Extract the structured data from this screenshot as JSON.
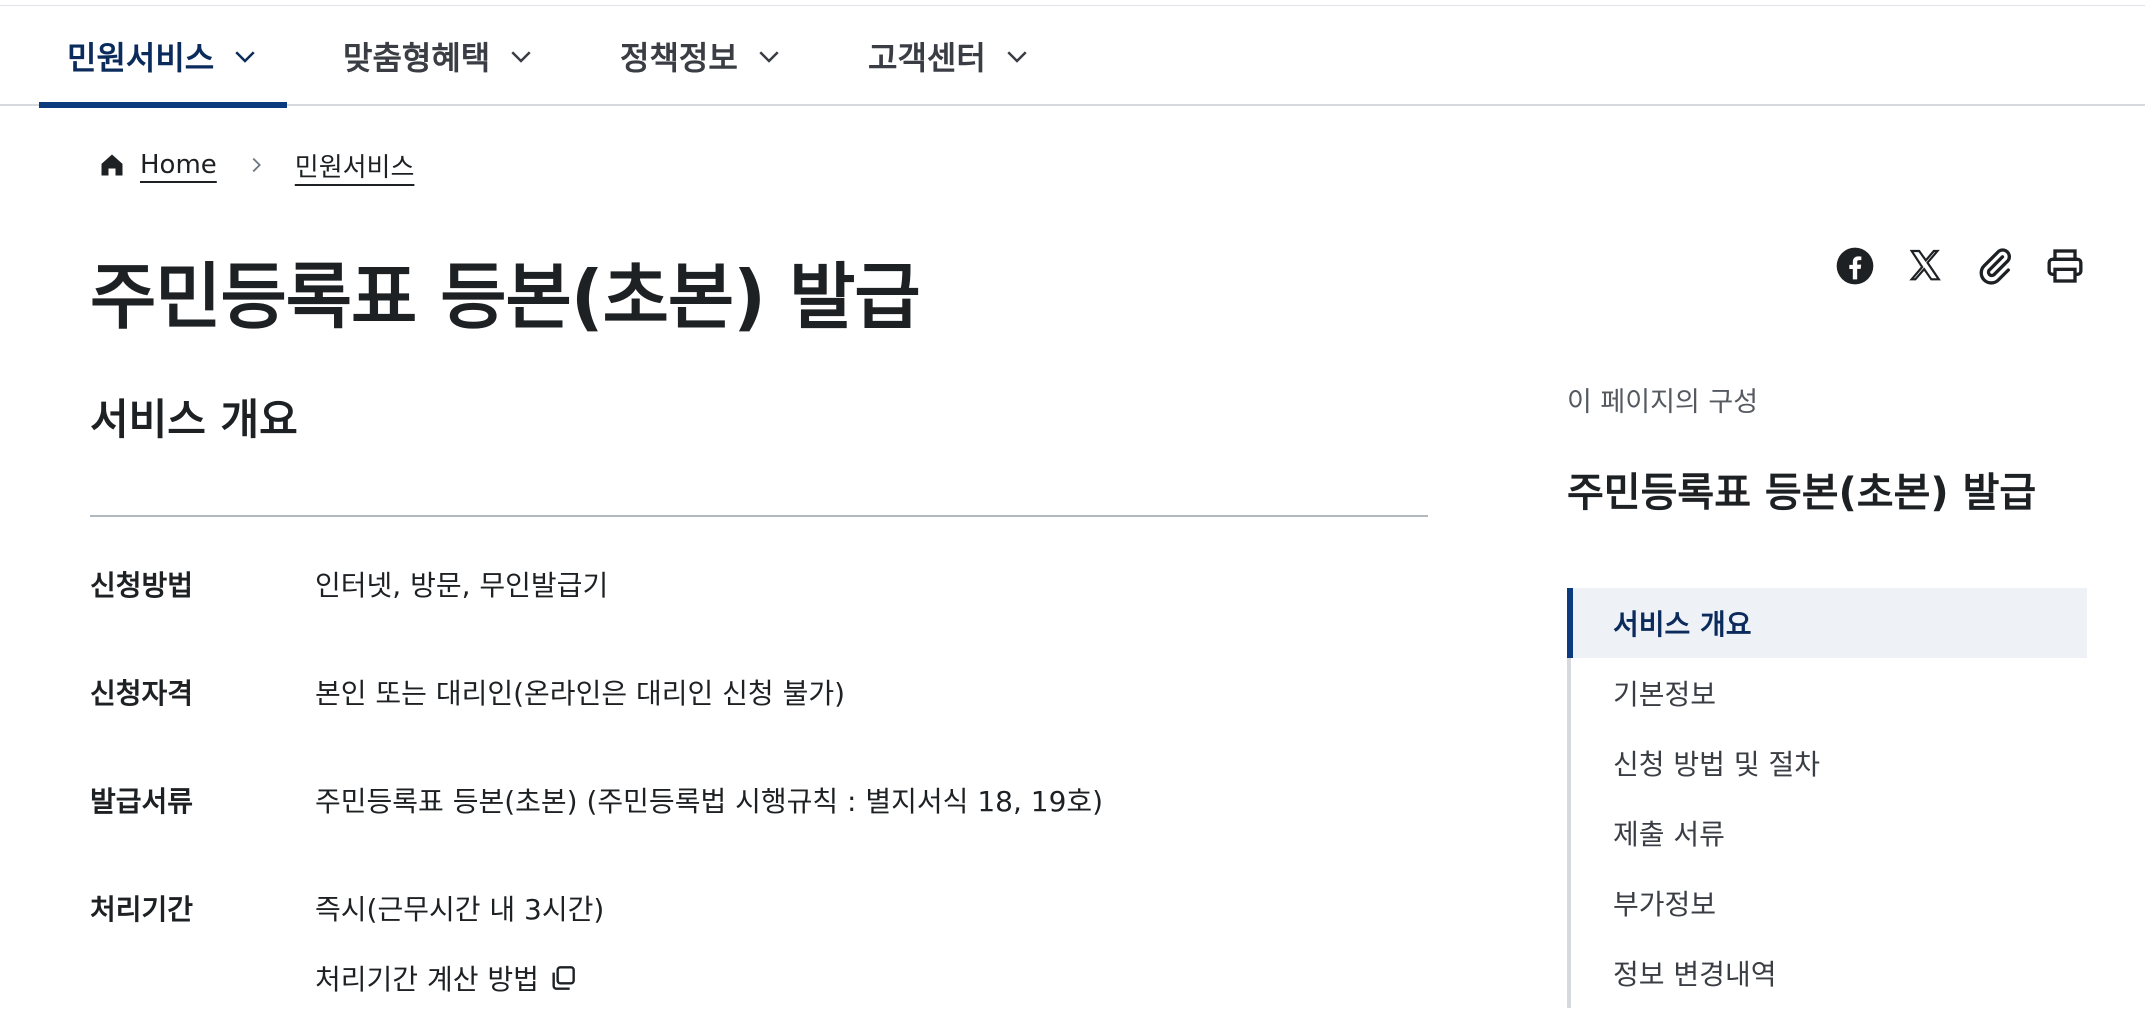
{
  "nav": {
    "items": [
      {
        "label": "민원서비스",
        "active": true
      },
      {
        "label": "맞춤형혜택",
        "active": false
      },
      {
        "label": "정책정보",
        "active": false
      },
      {
        "label": "고객센터",
        "active": false
      }
    ]
  },
  "breadcrumb": {
    "home": "Home",
    "current": "민원서비스"
  },
  "page": {
    "title": "주민등록표 등본(초본) 발급"
  },
  "share": {
    "icons": [
      "facebook-icon",
      "x-icon",
      "link-icon",
      "print-icon"
    ]
  },
  "overview": {
    "title": "서비스 개요",
    "rows": [
      {
        "label": "신청방법",
        "value": "인터넷, 방문, 무인발급기"
      },
      {
        "label": "신청자격",
        "value": "본인 또는 대리인(온라인은 대리인 신청 불가)"
      },
      {
        "label": "발급서류",
        "value": "주민등록표 등본(초본) (주민등록법 시행규칙 : 별지서식 18, 19호)"
      },
      {
        "label": "처리기간",
        "value": "즉시(근무시간 내 3시간)"
      }
    ],
    "processing_link": "처리기간 계산 방법"
  },
  "toc": {
    "caption": "이 페이지의 구성",
    "title": "주민등록표 등본(초본) 발급",
    "items": [
      {
        "label": "서비스 개요",
        "active": true
      },
      {
        "label": "기본정보",
        "active": false
      },
      {
        "label": "신청 방법 및 절차",
        "active": false
      },
      {
        "label": "제출 서류",
        "active": false
      },
      {
        "label": "부가정보",
        "active": false
      },
      {
        "label": "정보 변경내역",
        "active": false
      }
    ]
  },
  "colors": {
    "accent": "#0b3a7e",
    "active_text": "#0b2b5c",
    "toc_active_bg": "#eef1f6"
  }
}
